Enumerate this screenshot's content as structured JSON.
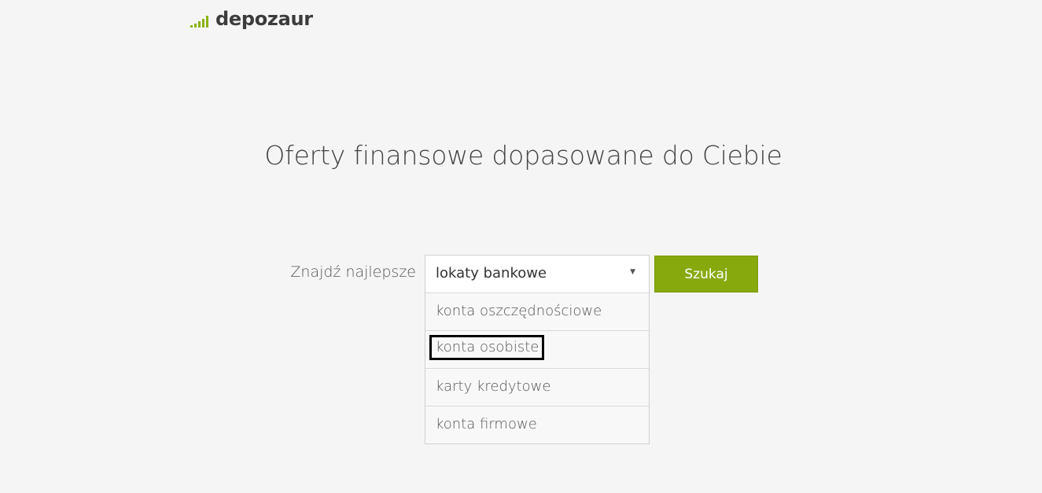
{
  "brand": {
    "name": "depozaur",
    "accent_color": "#8ab312",
    "logo_icon": "signal-bars-icon"
  },
  "hero": {
    "title": "Oferty finansowe dopasowane do Ciebie"
  },
  "search": {
    "label": "Znajdź najlepsze",
    "selected": "lokaty bankowe",
    "arrow_icon": "triangle-down-icon",
    "options": [
      {
        "label": "konta oszczędnościowe"
      },
      {
        "label": "konta osobiste"
      },
      {
        "label": "karty kredytowe"
      },
      {
        "label": "konta firmowe"
      }
    ],
    "button_label": "Szukaj",
    "button_color": "#87a90e"
  }
}
